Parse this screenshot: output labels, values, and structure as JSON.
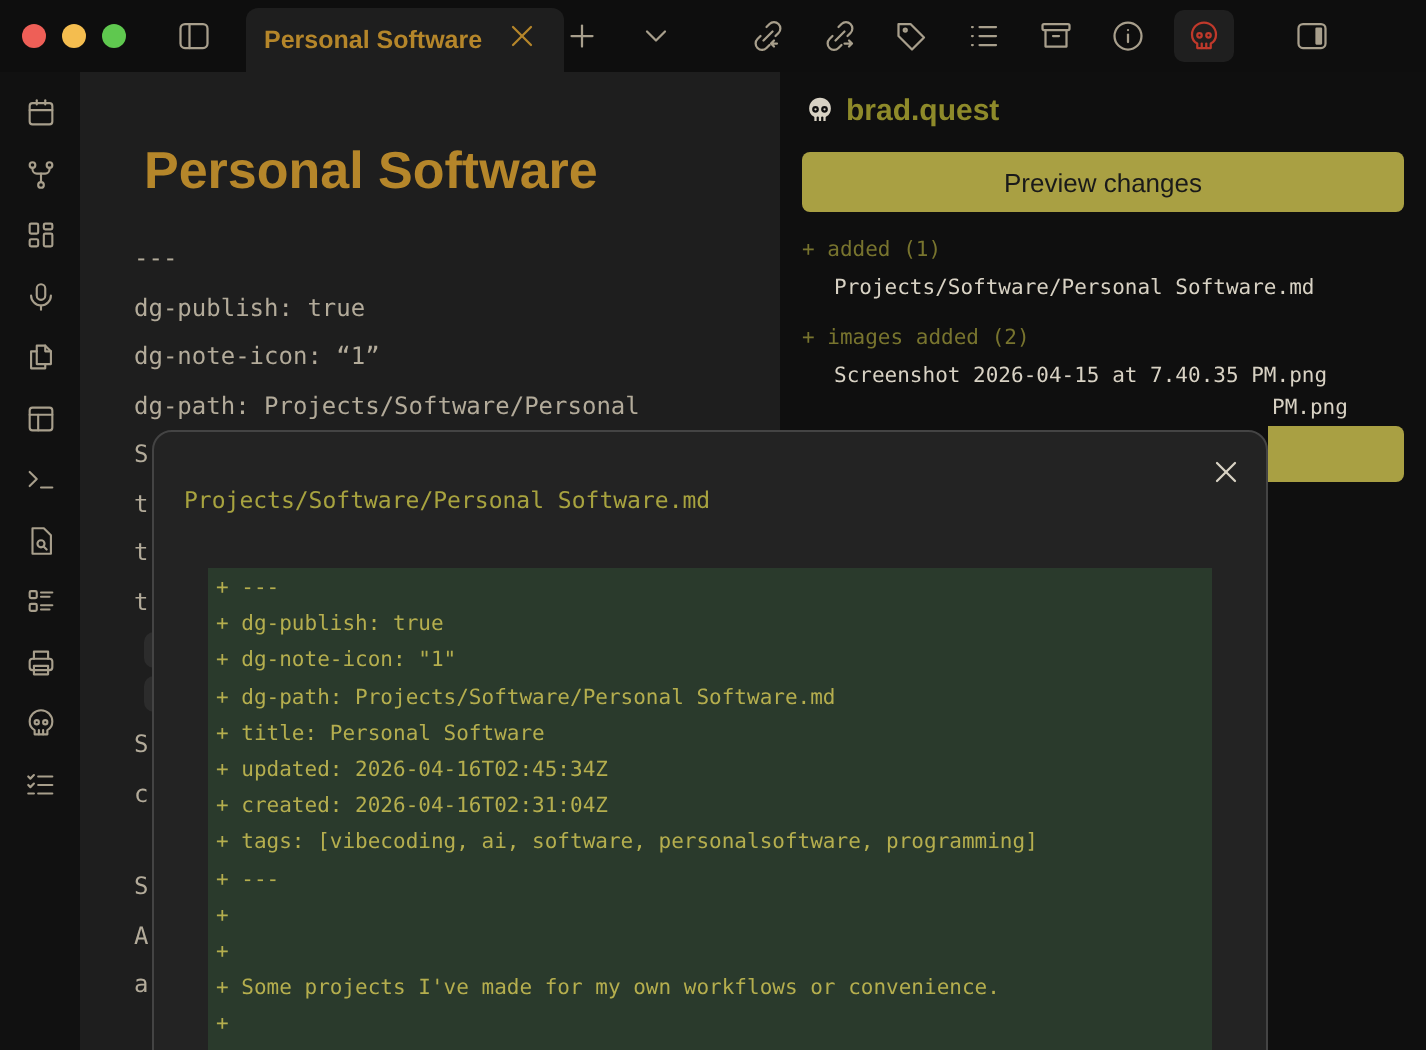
{
  "window": {
    "tab": {
      "title": "Personal Software",
      "selected": true
    }
  },
  "editor": {
    "title": "Personal Software",
    "lines": [
      {
        "kind": "text",
        "text": "---"
      },
      {
        "kind": "text",
        "text": "dg-publish: true"
      },
      {
        "kind": "text",
        "text": "dg-note-icon: “1”"
      },
      {
        "kind": "text",
        "text": "dg-path: Projects/Software/Personal"
      },
      {
        "kind": "text",
        "text": "S"
      },
      {
        "kind": "text",
        "text": "t"
      },
      {
        "kind": "text",
        "text": "t"
      },
      {
        "kind": "text",
        "text": "t"
      },
      {
        "kind": "chip"
      },
      {
        "kind": "chip"
      },
      {
        "kind": "text",
        "text": "S"
      },
      {
        "kind": "text",
        "text": "c"
      },
      {
        "kind": "gap"
      },
      {
        "kind": "text",
        "text": "S"
      },
      {
        "kind": "text",
        "text": "A"
      },
      {
        "kind": "text",
        "text": "a"
      }
    ]
  },
  "publish_panel": {
    "site": "brad.quest",
    "preview_button": "Preview changes",
    "groups": [
      {
        "heading": "+ added (1)",
        "files": [
          {
            "name": "Projects/Software/Personal Software.md",
            "partial": false
          }
        ]
      },
      {
        "heading": "+ images added (2)",
        "files": [
          {
            "name": "Screenshot 2026-04-15 at 7.40.35 PM.png",
            "partial": false
          },
          {
            "name": "PM.png",
            "partial": true
          }
        ]
      }
    ]
  },
  "modal": {
    "title": "Projects/Software/Personal Software.md",
    "diff_lines": [
      "+ ---",
      "+ dg-publish: true",
      "+ dg-note-icon: \"1\"",
      "+ dg-path: Projects/Software/Personal Software.md",
      "+ title: Personal Software",
      "+ updated: 2026-04-16T02:45:34Z",
      "+ created: 2026-04-16T02:31:04Z",
      "+ tags: [vibecoding, ai, software, personalsoftware, programming]",
      "+ ---",
      "+",
      "+",
      "+ Some projects I've made for my own workflows or convenience.",
      "+"
    ]
  }
}
